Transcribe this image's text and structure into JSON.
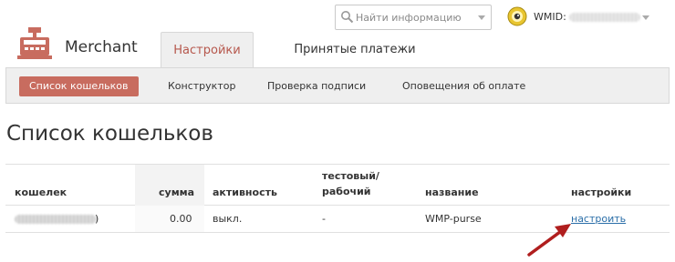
{
  "search": {
    "placeholder": "Найти информацию",
    "icon": "search-icon"
  },
  "account": {
    "label": "WMID:",
    "icon": "keeper-avatar-icon"
  },
  "brand": {
    "name": "Merchant",
    "icon": "cash-register-icon",
    "accent": "#c86c5f"
  },
  "tabs": [
    {
      "label": "Настройки",
      "active": true
    },
    {
      "label": "Принятые платежи",
      "active": false
    }
  ],
  "subnav": [
    {
      "label": "Список кошельков",
      "active": true
    },
    {
      "label": "Конструктор",
      "active": false
    },
    {
      "label": "Проверка подписи",
      "active": false
    },
    {
      "label": "Оповещения об оплате",
      "active": false
    }
  ],
  "page": {
    "title": "Список кошельков"
  },
  "table": {
    "columns": {
      "purse": "кошелек",
      "amount": "сумма",
      "activity": "активность",
      "mode_line1": "тестовый/",
      "mode_line2": "рабочий",
      "name": "название",
      "settings": "настройки"
    },
    "rows": [
      {
        "purse_suffix": ")",
        "amount": "0.00",
        "activity": "выкл.",
        "mode": "-",
        "name": "WMP-purse",
        "settings_link": "настроить"
      }
    ]
  },
  "annotation": {
    "arrow_color": "#b01e1e"
  }
}
